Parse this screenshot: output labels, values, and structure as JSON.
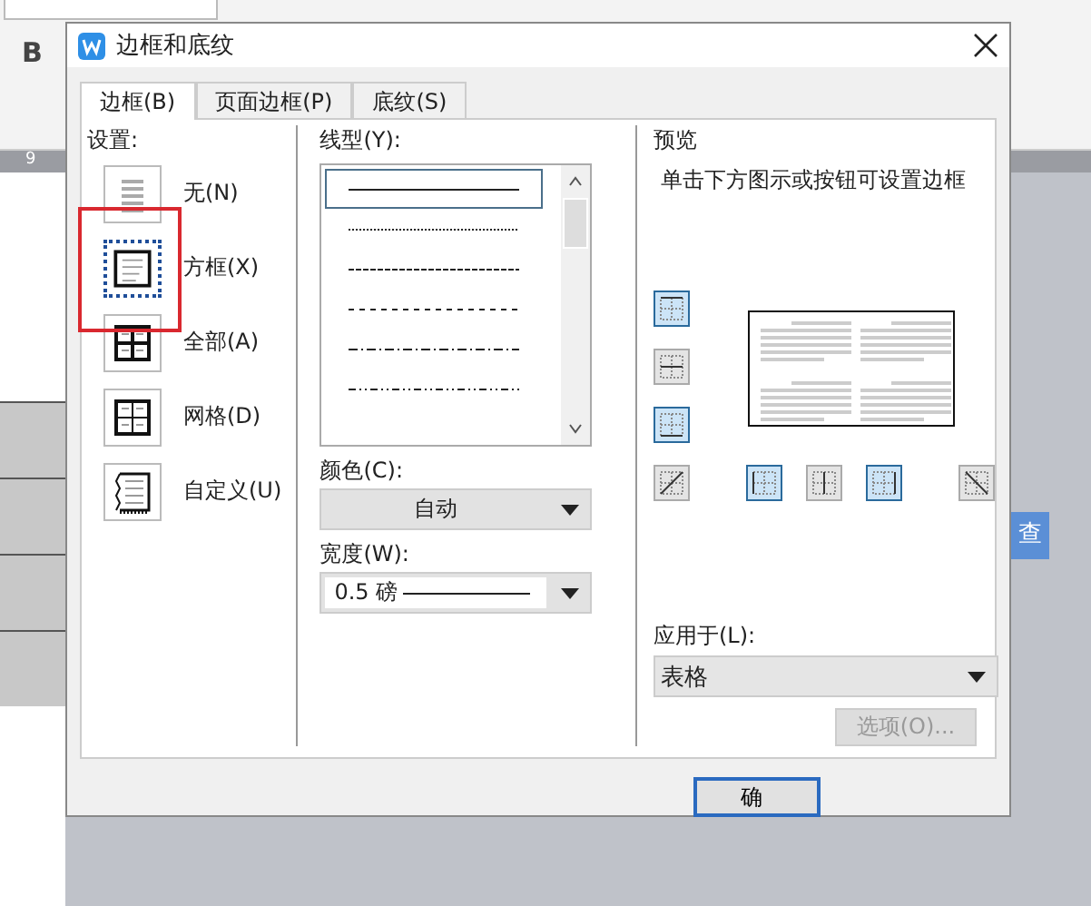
{
  "app": {
    "bold": "B",
    "ruler": "9",
    "side_button": "查"
  },
  "dialog": {
    "title": "边框和底纹",
    "tabs": [
      {
        "label": "边框(B)",
        "selected": true
      },
      {
        "label": "页面边框(P)",
        "selected": false
      },
      {
        "label": "底纹(S)",
        "selected": false
      }
    ],
    "settings": {
      "label": "设置:",
      "items": [
        {
          "kind": "none",
          "label": "无(N)",
          "selected": false
        },
        {
          "kind": "box",
          "label": "方框(X)",
          "selected": true
        },
        {
          "kind": "all",
          "label": "全部(A)",
          "selected": false
        },
        {
          "kind": "grid",
          "label": "网格(D)",
          "selected": false
        },
        {
          "kind": "custom",
          "label": "自定义(U)",
          "selected": false
        }
      ]
    },
    "line_style": {
      "label": "线型(Y):",
      "styles": [
        {
          "kind": "solid",
          "selected": true
        },
        {
          "kind": "dotted",
          "selected": false
        },
        {
          "kind": "dashed",
          "selected": false
        },
        {
          "kind": "sparse",
          "selected": false
        },
        {
          "kind": "dashdot",
          "selected": false
        },
        {
          "kind": "dashdotdot",
          "selected": false
        }
      ]
    },
    "color": {
      "label": "颜色(C):",
      "value": "自动"
    },
    "width": {
      "label": "宽度(W):",
      "value": "0.5 磅"
    },
    "preview": {
      "label": "预览",
      "hint": "单击下方图示或按钮可设置边框",
      "side_buttons": [
        {
          "kind": "top",
          "on": true
        },
        {
          "kind": "middle",
          "on": false
        },
        {
          "kind": "bottom",
          "on": true
        }
      ],
      "bottom_buttons": [
        {
          "kind": "diag-up",
          "on": false
        },
        {
          "kind": "left",
          "on": true
        },
        {
          "kind": "center",
          "on": false
        },
        {
          "kind": "right",
          "on": true
        },
        {
          "kind": "diag-down",
          "on": false
        }
      ]
    },
    "apply_to": {
      "label": "应用于(L):",
      "value": "表格"
    },
    "options_button": {
      "label": "选项(O)...",
      "disabled": true
    },
    "ok_button": {
      "label": "确"
    }
  }
}
